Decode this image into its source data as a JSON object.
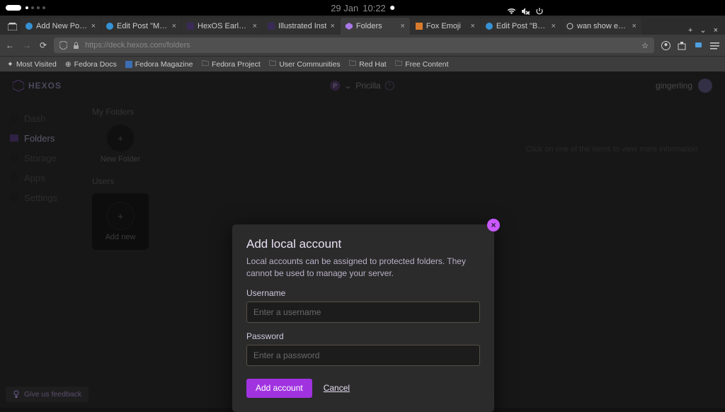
{
  "system": {
    "date": "29 Jan",
    "time": "10:22"
  },
  "browser": {
    "tabs": [
      {
        "label": "Add New Post ‹ A"
      },
      {
        "label": "Edit Post \"Makin"
      },
      {
        "label": "HexOS Early A"
      },
      {
        "label": "Illustrated Inst"
      },
      {
        "label": "Folders"
      },
      {
        "label": "Fox Emoji"
      },
      {
        "label": "Edit Post \"Buildi"
      },
      {
        "label": "wan show emoji"
      }
    ],
    "url": "https://deck.hexos.com/folders",
    "bookmarks": [
      "Most Visited",
      "Fedora Docs",
      "Fedora Magazine",
      "Fedora Project",
      "User Communities",
      "Red Hat",
      "Free Content"
    ]
  },
  "app": {
    "brand": "HEXOS",
    "user_mid": "Pricilla",
    "user_right": "gingerling",
    "sidebar": [
      "Dash",
      "Folders",
      "Storage",
      "Apps",
      "Settings"
    ],
    "myfolders_title": "My Folders",
    "new_folder_label": "New Folder",
    "users_title": "Users",
    "add_new_label": "Add new",
    "info_placeholder": "Click on one of the items to view more information",
    "feedback": "Give us feedback"
  },
  "modal": {
    "title": "Add local account",
    "desc": "Local accounts can be assigned to protected folders. They cannot be used to manage your server.",
    "username_label": "Username",
    "username_ph": "Enter a username",
    "password_label": "Password",
    "password_ph": "Enter a password",
    "submit": "Add account",
    "cancel": "Cancel"
  }
}
